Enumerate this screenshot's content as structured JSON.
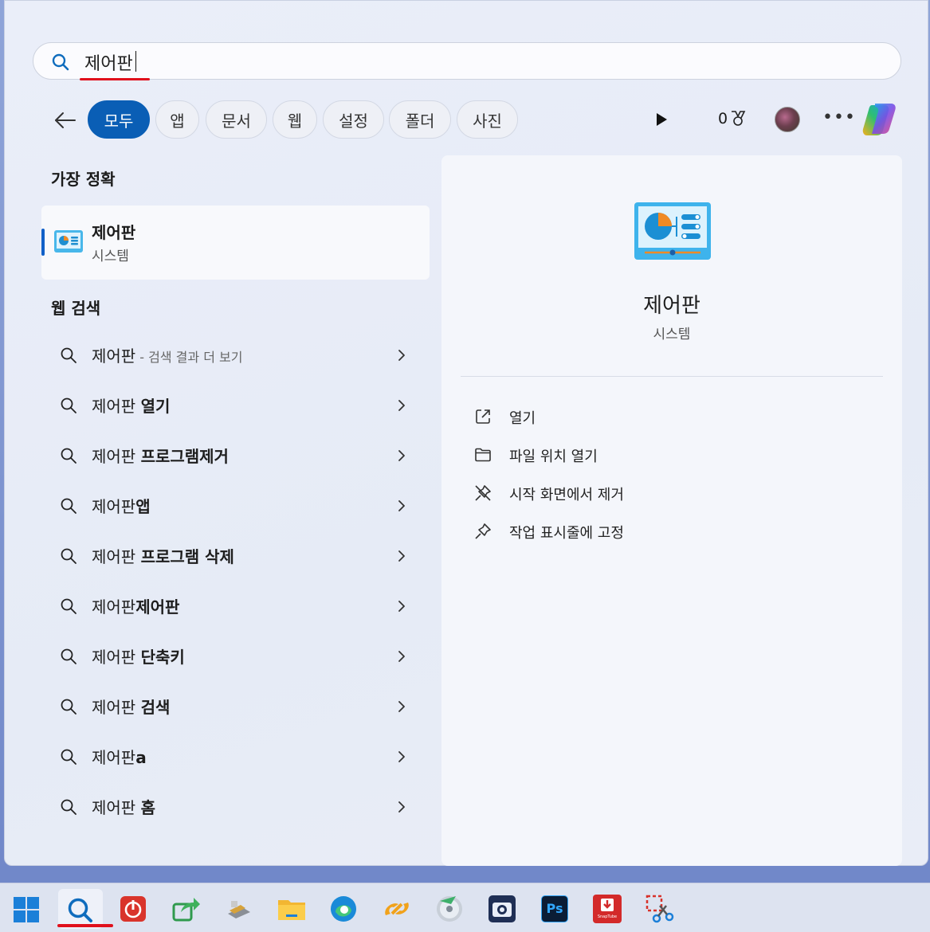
{
  "search": {
    "query": "제어판"
  },
  "filters": [
    "모두",
    "앱",
    "문서",
    "웹",
    "설정",
    "폴더",
    "사진"
  ],
  "toolbar": {
    "points": "0"
  },
  "best_match": {
    "heading": "가장 정확",
    "name": "제어판",
    "type": "시스템"
  },
  "web_search": {
    "heading": "웹 검색",
    "items": [
      {
        "prefix": "제어판",
        "bold": "",
        "muted": " - 검색 결과 더 보기"
      },
      {
        "prefix": "제어판 ",
        "bold": "열기",
        "muted": ""
      },
      {
        "prefix": "제어판 ",
        "bold": "프로그램제거",
        "muted": ""
      },
      {
        "prefix": "제어판",
        "bold": "앱",
        "muted": ""
      },
      {
        "prefix": "제어판 ",
        "bold": "프로그램 삭제",
        "muted": ""
      },
      {
        "prefix": "제어판",
        "bold": "제어판",
        "muted": ""
      },
      {
        "prefix": "제어판 ",
        "bold": "단축키",
        "muted": ""
      },
      {
        "prefix": "제어판 ",
        "bold": "검색",
        "muted": ""
      },
      {
        "prefix": "제어판",
        "bold": "a",
        "muted": ""
      },
      {
        "prefix": "제어판 ",
        "bold": "홈",
        "muted": ""
      }
    ]
  },
  "detail": {
    "name": "제어판",
    "type": "시스템",
    "actions": [
      {
        "label": "열기",
        "icon": "open-external-icon"
      },
      {
        "label": "파일 위치 열기",
        "icon": "folder-icon"
      },
      {
        "label": "시작 화면에서 제거",
        "icon": "unpin-icon"
      },
      {
        "label": "작업 표시줄에 고정",
        "icon": "pin-icon"
      }
    ]
  },
  "taskbar": {
    "icons": [
      "windows-start-icon",
      "search-icon",
      "power-app-icon",
      "share-arrow-icon",
      "usb-drive-icon",
      "file-explorer-icon",
      "edge-icon",
      "link-app-icon",
      "disc-burner-icon",
      "camera-app-icon",
      "photoshop-icon",
      "snaptube-icon",
      "snipping-tool-icon"
    ],
    "photoshop_label": "Ps",
    "snaptube_label": "SnapTube"
  },
  "colors": {
    "accent": "#0a5eb5",
    "underline": "#e0101c"
  }
}
